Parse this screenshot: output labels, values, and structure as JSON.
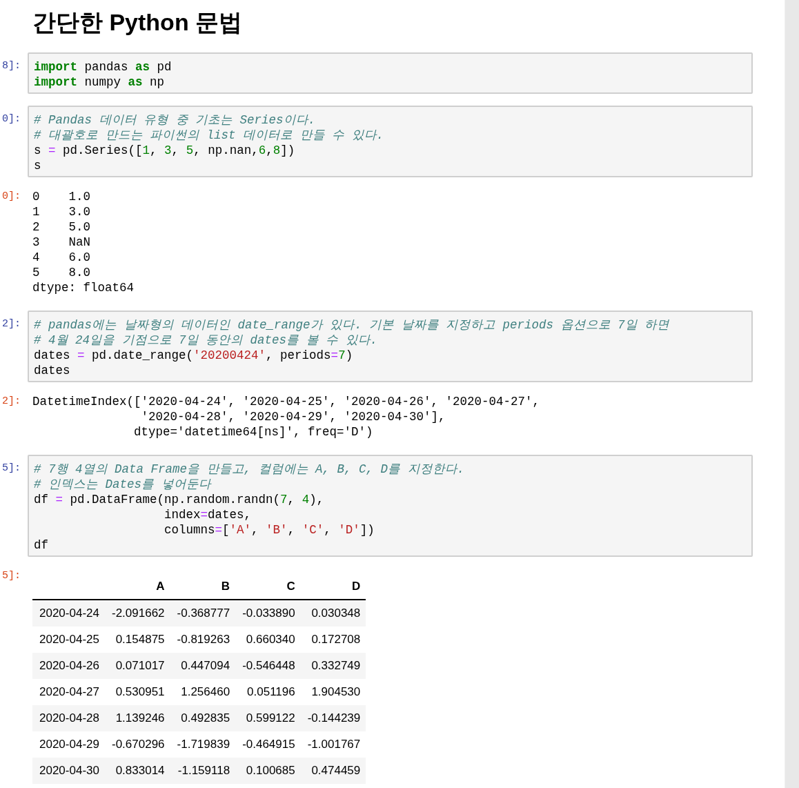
{
  "title": "간단한 Python 문법",
  "cells": [
    {
      "kind": "input",
      "prompt": "8]:",
      "lines": [
        [
          {
            "kind": "kw",
            "text": "import"
          },
          {
            "kind": "plain",
            "text": " pandas "
          },
          {
            "kind": "kw",
            "text": "as"
          },
          {
            "kind": "plain",
            "text": " pd"
          }
        ],
        [
          {
            "kind": "kw",
            "text": "import"
          },
          {
            "kind": "plain",
            "text": " numpy "
          },
          {
            "kind": "kw",
            "text": "as"
          },
          {
            "kind": "plain",
            "text": " np"
          }
        ]
      ]
    },
    {
      "kind": "input",
      "prompt": "0]:",
      "lines": [
        [
          {
            "kind": "comment",
            "text": "# Pandas 데이터 유형 중 기초는 Series이다."
          }
        ],
        [
          {
            "kind": "comment",
            "text": "# 대괄호로 만드는 파이썬의 list 데이터로 만들 수 있다."
          }
        ],
        [
          {
            "kind": "plain",
            "text": "s "
          },
          {
            "kind": "op",
            "text": "="
          },
          {
            "kind": "plain",
            "text": " pd.Series(["
          },
          {
            "kind": "num",
            "text": "1"
          },
          {
            "kind": "plain",
            "text": ", "
          },
          {
            "kind": "num",
            "text": "3"
          },
          {
            "kind": "plain",
            "text": ", "
          },
          {
            "kind": "num",
            "text": "5"
          },
          {
            "kind": "plain",
            "text": ", np.nan,"
          },
          {
            "kind": "num",
            "text": "6"
          },
          {
            "kind": "plain",
            "text": ","
          },
          {
            "kind": "num",
            "text": "8"
          },
          {
            "kind": "plain",
            "text": "])"
          }
        ],
        [
          {
            "kind": "plain",
            "text": "s"
          }
        ]
      ]
    },
    {
      "kind": "output",
      "prompt": "0]:",
      "lines": [
        "0    1.0",
        "1    3.0",
        "2    5.0",
        "3    NaN",
        "4    6.0",
        "5    8.0",
        "dtype: float64"
      ]
    },
    {
      "kind": "input",
      "prompt": "2]:",
      "lines": [
        [
          {
            "kind": "comment",
            "text": "# pandas에는 날짜형의 데이터인 date_range가 있다. 기본 날짜를 지정하고 periods 옵션으로 7일 하면"
          }
        ],
        [
          {
            "kind": "comment",
            "text": "# 4월 24일을 기점으로 7일 동안의 dates를 볼 수 있다."
          }
        ],
        [
          {
            "kind": "plain",
            "text": "dates "
          },
          {
            "kind": "op",
            "text": "="
          },
          {
            "kind": "plain",
            "text": " pd.date_range("
          },
          {
            "kind": "str",
            "text": "'20200424'"
          },
          {
            "kind": "plain",
            "text": ", periods"
          },
          {
            "kind": "op",
            "text": "="
          },
          {
            "kind": "num",
            "text": "7"
          },
          {
            "kind": "plain",
            "text": ")"
          }
        ],
        [
          {
            "kind": "plain",
            "text": "dates"
          }
        ]
      ]
    },
    {
      "kind": "output",
      "prompt": "2]:",
      "lines": [
        "DatetimeIndex(['2020-04-24', '2020-04-25', '2020-04-26', '2020-04-27',",
        "               '2020-04-28', '2020-04-29', '2020-04-30'],",
        "              dtype='datetime64[ns]', freq='D')"
      ]
    },
    {
      "kind": "input",
      "prompt": "5]:",
      "lines": [
        [
          {
            "kind": "comment",
            "text": "# 7행 4열의 Data Frame을 만들고, 컬럼에는 A, B, C, D를 지정한다."
          }
        ],
        [
          {
            "kind": "comment",
            "text": "# 인덱스는 Dates를 넣어둔다"
          }
        ],
        [
          {
            "kind": "plain",
            "text": "df "
          },
          {
            "kind": "op",
            "text": "="
          },
          {
            "kind": "plain",
            "text": " pd.DataFrame(np.random.randn("
          },
          {
            "kind": "num",
            "text": "7"
          },
          {
            "kind": "plain",
            "text": ", "
          },
          {
            "kind": "num",
            "text": "4"
          },
          {
            "kind": "plain",
            "text": "),"
          }
        ],
        [
          {
            "kind": "plain",
            "text": "                  index"
          },
          {
            "kind": "op",
            "text": "="
          },
          {
            "kind": "plain",
            "text": "dates,"
          }
        ],
        [
          {
            "kind": "plain",
            "text": "                  columns"
          },
          {
            "kind": "op",
            "text": "="
          },
          {
            "kind": "plain",
            "text": "["
          },
          {
            "kind": "str",
            "text": "'A'"
          },
          {
            "kind": "plain",
            "text": ", "
          },
          {
            "kind": "str",
            "text": "'B'"
          },
          {
            "kind": "plain",
            "text": ", "
          },
          {
            "kind": "str",
            "text": "'C'"
          },
          {
            "kind": "plain",
            "text": ", "
          },
          {
            "kind": "str",
            "text": "'D'"
          },
          {
            "kind": "plain",
            "text": "])"
          }
        ],
        [
          {
            "kind": "plain",
            "text": "df"
          }
        ]
      ]
    },
    {
      "kind": "table",
      "prompt": "5]:",
      "columns": [
        "A",
        "B",
        "C",
        "D"
      ],
      "rows": [
        {
          "index": "2020-04-24",
          "cells": [
            "-2.091662",
            "-0.368777",
            "-0.033890",
            "0.030348"
          ]
        },
        {
          "index": "2020-04-25",
          "cells": [
            "0.154875",
            "-0.819263",
            "0.660340",
            "0.172708"
          ]
        },
        {
          "index": "2020-04-26",
          "cells": [
            "0.071017",
            "0.447094",
            "-0.546448",
            "0.332749"
          ]
        },
        {
          "index": "2020-04-27",
          "cells": [
            "0.530951",
            "1.256460",
            "0.051196",
            "1.904530"
          ]
        },
        {
          "index": "2020-04-28",
          "cells": [
            "1.139246",
            "0.492835",
            "0.599122",
            "-0.144239"
          ]
        },
        {
          "index": "2020-04-29",
          "cells": [
            "-0.670296",
            "-1.719839",
            "-0.464915",
            "-1.001767"
          ]
        },
        {
          "index": "2020-04-30",
          "cells": [
            "0.833014",
            "-1.159118",
            "0.100685",
            "0.474459"
          ]
        }
      ]
    }
  ]
}
